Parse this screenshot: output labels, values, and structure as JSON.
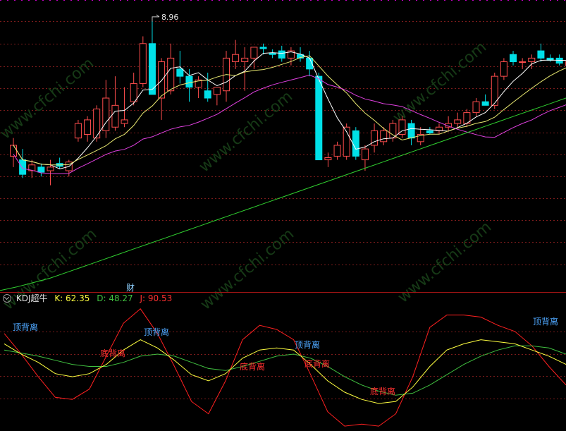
{
  "colors": {
    "background": "#000000",
    "grid": "#7a1b1b",
    "separator": "#a01414",
    "up_candle": "#ff4d4d",
    "down_candle": "#00e0e8",
    "ma_fast": "#ffffff",
    "ma_mid": "#e8e870",
    "ma_slow": "#e040e0",
    "ma_long": "#30d030",
    "k_line": "#ffff40",
    "d_line": "#40c040",
    "j_line": "#ff2020",
    "top_div": "#4fa8ff",
    "bottom_div": "#ff3030",
    "watermark": "#163a16"
  },
  "watermark_text": "www.cfchi.com",
  "marker_label": "财",
  "indicator": {
    "icon": "circle-chevron-icon",
    "name": "KDJ超牛",
    "k_label": "K: 62.35",
    "d_label": "D: 48.27",
    "j_label": "J: 90.53"
  },
  "chart_data": [
    {
      "type": "candlestick",
      "title": "",
      "price_range": [
        5.23,
        9.25
      ],
      "high_annotation": "8.96",
      "candles": [
        {
          "o": 7.1,
          "h": 7.35,
          "l": 6.95,
          "c": 7.25
        },
        {
          "o": 7.05,
          "h": 7.2,
          "l": 6.8,
          "c": 6.85
        },
        {
          "o": 6.9,
          "h": 7.05,
          "l": 6.8,
          "c": 6.98
        },
        {
          "o": 6.95,
          "h": 7.0,
          "l": 6.82,
          "c": 6.88
        },
        {
          "o": 6.9,
          "h": 7.05,
          "l": 6.7,
          "c": 6.95
        },
        {
          "o": 7.0,
          "h": 7.08,
          "l": 6.92,
          "c": 6.96
        },
        {
          "o": 6.9,
          "h": 7.05,
          "l": 6.82,
          "c": 7.02
        },
        {
          "o": 7.35,
          "h": 7.6,
          "l": 7.3,
          "c": 7.55
        },
        {
          "o": 7.4,
          "h": 7.65,
          "l": 7.3,
          "c": 7.6
        },
        {
          "o": 7.35,
          "h": 7.8,
          "l": 7.3,
          "c": 7.75
        },
        {
          "o": 7.45,
          "h": 8.15,
          "l": 7.35,
          "c": 7.9
        },
        {
          "o": 7.5,
          "h": 8.2,
          "l": 7.45,
          "c": 7.8
        },
        {
          "o": 7.55,
          "h": 8.05,
          "l": 7.5,
          "c": 7.6
        },
        {
          "o": 7.85,
          "h": 8.25,
          "l": 7.8,
          "c": 8.1
        },
        {
          "o": 8.1,
          "h": 8.75,
          "l": 8.05,
          "c": 8.65
        },
        {
          "o": 8.65,
          "h": 8.96,
          "l": 7.95,
          "c": 7.95
        },
        {
          "o": 7.9,
          "h": 8.45,
          "l": 7.6,
          "c": 8.4
        },
        {
          "o": 8.0,
          "h": 8.65,
          "l": 7.95,
          "c": 8.45
        },
        {
          "o": 8.3,
          "h": 8.55,
          "l": 8.1,
          "c": 8.2
        },
        {
          "o": 8.2,
          "h": 8.3,
          "l": 7.85,
          "c": 8.05
        },
        {
          "o": 8.05,
          "h": 8.2,
          "l": 7.9,
          "c": 8.15
        },
        {
          "o": 8.0,
          "h": 8.25,
          "l": 7.85,
          "c": 7.9
        },
        {
          "o": 7.95,
          "h": 8.05,
          "l": 7.8,
          "c": 8.05
        },
        {
          "o": 8.0,
          "h": 8.55,
          "l": 7.85,
          "c": 8.45
        },
        {
          "o": 8.4,
          "h": 8.7,
          "l": 8.3,
          "c": 8.5
        },
        {
          "o": 8.4,
          "h": 8.6,
          "l": 8.0,
          "c": 8.45
        },
        {
          "o": 8.45,
          "h": 8.55,
          "l": 8.3,
          "c": 8.6
        },
        {
          "o": 8.6,
          "h": 8.65,
          "l": 8.5,
          "c": 8.58
        },
        {
          "o": 8.52,
          "h": 8.57,
          "l": 8.45,
          "c": 8.5
        },
        {
          "o": 8.55,
          "h": 8.62,
          "l": 8.4,
          "c": 8.45
        },
        {
          "o": 8.45,
          "h": 8.6,
          "l": 8.35,
          "c": 8.55
        },
        {
          "o": 8.5,
          "h": 8.6,
          "l": 8.4,
          "c": 8.45
        },
        {
          "o": 8.45,
          "h": 8.55,
          "l": 8.2,
          "c": 8.3
        },
        {
          "o": 8.2,
          "h": 8.25,
          "l": 7.05,
          "c": 7.05
        },
        {
          "o": 7.05,
          "h": 7.15,
          "l": 6.95,
          "c": 7.08
        },
        {
          "o": 7.1,
          "h": 7.3,
          "l": 7.05,
          "c": 7.25
        },
        {
          "o": 7.1,
          "h": 7.55,
          "l": 7.05,
          "c": 7.5
        },
        {
          "o": 7.45,
          "h": 7.5,
          "l": 7.05,
          "c": 7.1
        },
        {
          "o": 7.05,
          "h": 7.25,
          "l": 6.9,
          "c": 7.2
        },
        {
          "o": 7.25,
          "h": 7.55,
          "l": 7.15,
          "c": 7.45
        },
        {
          "o": 7.3,
          "h": 7.5,
          "l": 7.25,
          "c": 7.45
        },
        {
          "o": 7.35,
          "h": 7.6,
          "l": 7.3,
          "c": 7.55
        },
        {
          "o": 7.4,
          "h": 7.65,
          "l": 7.35,
          "c": 7.6
        },
        {
          "o": 7.55,
          "h": 7.6,
          "l": 7.25,
          "c": 7.35
        },
        {
          "o": 7.3,
          "h": 7.5,
          "l": 7.25,
          "c": 7.4
        },
        {
          "o": 7.45,
          "h": 7.5,
          "l": 7.4,
          "c": 7.42
        },
        {
          "o": 7.45,
          "h": 7.55,
          "l": 7.4,
          "c": 7.5
        },
        {
          "o": 7.5,
          "h": 7.65,
          "l": 7.45,
          "c": 7.55
        },
        {
          "o": 7.55,
          "h": 7.7,
          "l": 7.5,
          "c": 7.6
        },
        {
          "o": 7.55,
          "h": 7.75,
          "l": 7.5,
          "c": 7.7
        },
        {
          "o": 7.7,
          "h": 7.9,
          "l": 7.65,
          "c": 7.85
        },
        {
          "o": 7.85,
          "h": 7.95,
          "l": 7.8,
          "c": 7.8
        },
        {
          "o": 7.8,
          "h": 8.25,
          "l": 7.75,
          "c": 8.2
        },
        {
          "o": 8.2,
          "h": 8.45,
          "l": 8.15,
          "c": 8.4
        },
        {
          "o": 8.5,
          "h": 8.55,
          "l": 8.35,
          "c": 8.4
        },
        {
          "o": 8.4,
          "h": 8.45,
          "l": 8.3,
          "c": 8.4
        },
        {
          "o": 8.4,
          "h": 8.5,
          "l": 8.3,
          "c": 8.45
        },
        {
          "o": 8.55,
          "h": 8.65,
          "l": 8.4,
          "c": 8.45
        },
        {
          "o": 8.45,
          "h": 8.5,
          "l": 8.4,
          "c": 8.42
        },
        {
          "o": 8.45,
          "h": 8.5,
          "l": 8.35,
          "c": 8.38
        },
        {
          "o": 8.35,
          "h": 8.45,
          "l": 8.25,
          "c": 8.4
        },
        {
          "o": 8.4,
          "h": 8.45,
          "l": 8.3,
          "c": 8.35
        }
      ],
      "ma_long": [
        5.25,
        5.3,
        5.36,
        5.42,
        5.5,
        5.58,
        5.66,
        5.74,
        5.82,
        5.9,
        5.98,
        6.06,
        6.14,
        6.22,
        6.3,
        6.38,
        6.46,
        6.54,
        6.62,
        6.7,
        6.78,
        6.86,
        6.94,
        7.02,
        7.1,
        7.18,
        7.26,
        7.34,
        7.42,
        7.5,
        7.58,
        7.66,
        7.74,
        7.82,
        7.9
      ]
    },
    {
      "type": "line",
      "title": "",
      "range": [
        -10,
        110
      ],
      "series": [
        {
          "name": "K",
          "values": [
            72,
            62,
            54,
            43,
            40,
            43,
            52,
            66,
            76,
            68,
            56,
            42,
            36,
            43,
            58,
            66,
            68,
            66,
            52,
            36,
            25,
            18,
            14,
            16,
            30,
            50,
            66,
            72,
            76,
            74,
            72,
            66,
            60,
            52
          ]
        },
        {
          "name": "D",
          "values": [
            66,
            63,
            60,
            56,
            52,
            50,
            50,
            54,
            60,
            62,
            60,
            54,
            48,
            46,
            50,
            55,
            60,
            62,
            58,
            50,
            40,
            32,
            26,
            22,
            24,
            32,
            42,
            52,
            60,
            66,
            70,
            70,
            68,
            62
          ]
        },
        {
          "name": "J",
          "values": [
            82,
            62,
            40,
            20,
            18,
            28,
            60,
            92,
            106,
            82,
            50,
            16,
            4,
            36,
            76,
            90,
            86,
            76,
            42,
            6,
            -8,
            -6,
            -8,
            4,
            40,
            88,
            100,
            100,
            98,
            90,
            84,
            70,
            50,
            32
          ]
        }
      ],
      "annotations": [
        "顶背离",
        "底背离",
        "顶背离",
        "底背离",
        "顶背离",
        "底背离",
        "底背离",
        "顶背离"
      ]
    }
  ]
}
